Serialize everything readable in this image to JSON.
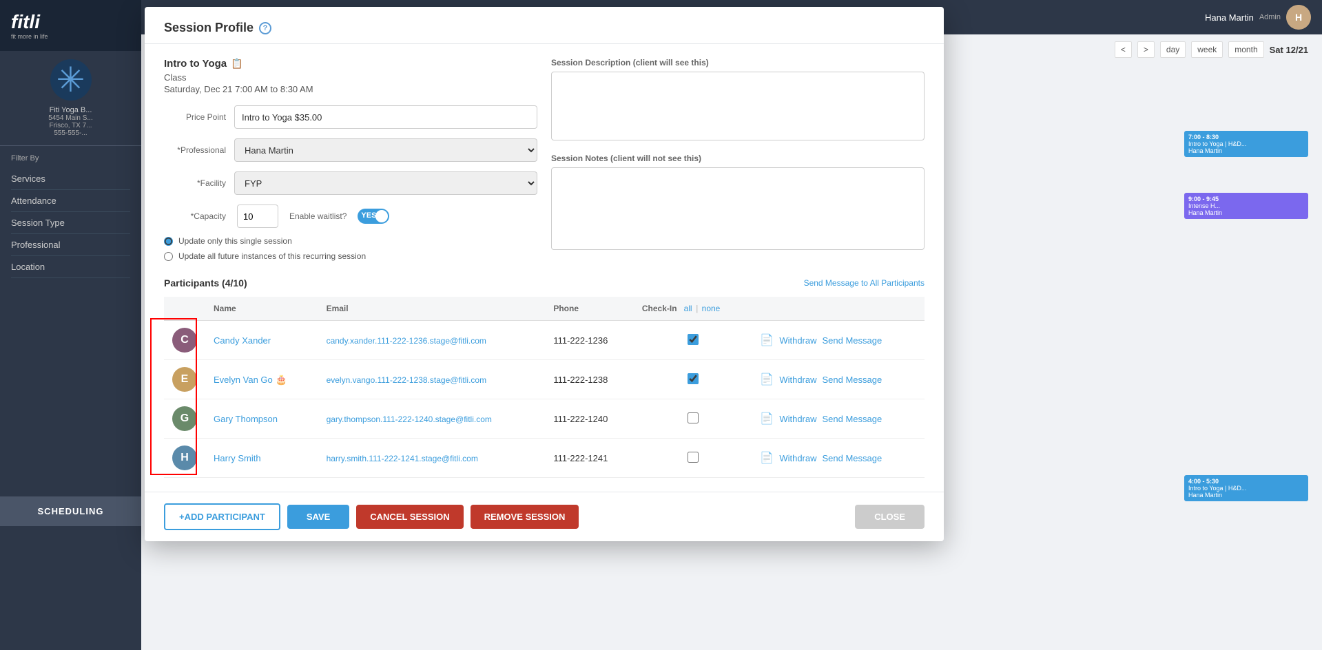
{
  "app": {
    "name": "fitli",
    "tagline": "fit more in life"
  },
  "topbar": {
    "user_name": "Hana Martin",
    "role": "Admin"
  },
  "sidebar": {
    "business_name": "Fiti Yoga B...",
    "address_line1": "5454 Main S...",
    "address_line2": "Frisco, TX 7...",
    "phone": "555-555-...",
    "filter_label": "Filter By",
    "nav_items": [
      {
        "label": "Services"
      },
      {
        "label": "Attendance"
      },
      {
        "label": "Session Type"
      },
      {
        "label": "Professional"
      },
      {
        "label": "Location"
      }
    ],
    "scheduling_btn": "SCHEDULING"
  },
  "calendar": {
    "nav": {
      "prev": "<",
      "next": ">",
      "day": "day",
      "week": "week",
      "month": "month",
      "current_date": "Sat 12/21"
    }
  },
  "modal": {
    "title": "Session Profile",
    "session_name": "Intro to Yoga",
    "session_type": "Class",
    "session_datetime": "Saturday, Dec 21   7:00 AM to 8:30 AM",
    "price_point_label": "Price Point",
    "price_point_value": "Intro to Yoga $35.00",
    "professional_label": "*Professional",
    "professional_value": "Hana Martin",
    "facility_label": "*Facility",
    "facility_value": "FYP",
    "capacity_label": "*Capacity",
    "capacity_value": "10",
    "waitlist_label": "Enable waitlist?",
    "waitlist_value": "YES",
    "radio_single": "Update only this single session",
    "radio_all": "Update all future instances of this recurring session",
    "description_label": "Session Description (client will see this)",
    "notes_label": "Session Notes (client will not see this)",
    "participants": {
      "title": "Participants (4/10)",
      "send_msg": "Send Message to All Participants",
      "col_name": "Name",
      "col_email": "Email",
      "col_phone": "Phone",
      "col_checkin": "Check-In",
      "col_all": "all",
      "col_none": "none",
      "rows": [
        {
          "name": "Candy Xander",
          "email": "candy.xander.111-222-1236.stage@fitli.com",
          "phone": "111-222-1236",
          "checked": true,
          "avatar_color": "#8a5c7a",
          "avatar_letter": "C"
        },
        {
          "name": "Evelyn Van Go",
          "email": "evelyn.vango.111-222-1238.stage@fitli.com",
          "phone": "111-222-1238",
          "checked": true,
          "avatar_color": "#c8a060",
          "avatar_letter": "E",
          "birthday": true
        },
        {
          "name": "Gary Thompson",
          "email": "gary.thompson.111-222-1240.stage@fitli.com",
          "phone": "111-222-1240",
          "checked": false,
          "avatar_color": "#6a8a6a",
          "avatar_letter": "G"
        },
        {
          "name": "Harry Smith",
          "email": "harry.smith.111-222-1241.stage@fitli.com",
          "phone": "111-222-1241",
          "checked": false,
          "avatar_color": "#5a8aaa",
          "avatar_letter": "H"
        }
      ]
    },
    "buttons": {
      "add": "+ADD PARTICIPANT",
      "save": "SAVE",
      "cancel_session": "CANCEL SESSION",
      "remove_session": "REMOVE SESSION",
      "close": "CLOSE"
    },
    "action_labels": {
      "withdraw": "Withdraw",
      "send_message": "Send Message"
    }
  }
}
